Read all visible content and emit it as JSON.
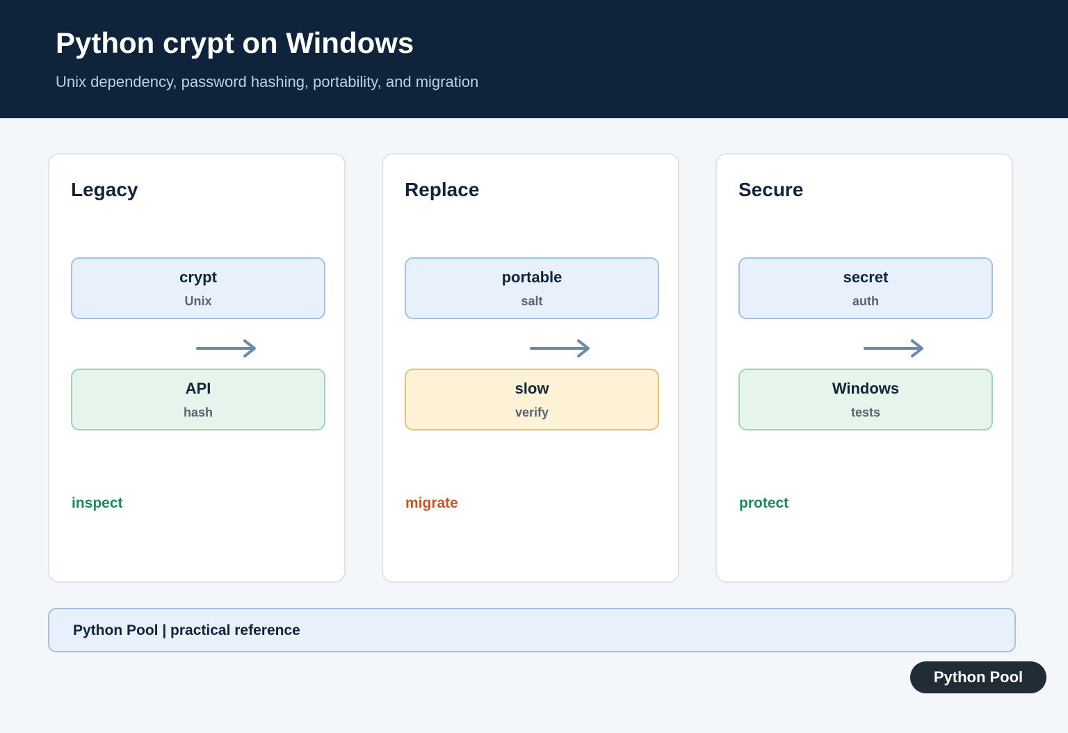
{
  "header": {
    "title": "Python crypt on Windows",
    "subtitle": "Unix dependency, password hashing, portability, and migration"
  },
  "panels": [
    {
      "title": "Legacy",
      "top_node": {
        "label": "crypt",
        "sub": "Unix",
        "style": "blue"
      },
      "bottom_node": {
        "label": "API",
        "sub": "hash",
        "style": "green"
      },
      "action": "inspect",
      "action_color": "#1e8a55"
    },
    {
      "title": "Replace",
      "top_node": {
        "label": "portable",
        "sub": "salt",
        "style": "blue"
      },
      "bottom_node": {
        "label": "slow",
        "sub": "verify",
        "style": "yellow"
      },
      "action": "migrate",
      "action_color": "#c0582a"
    },
    {
      "title": "Secure",
      "top_node": {
        "label": "secret",
        "sub": "auth",
        "style": "blue"
      },
      "bottom_node": {
        "label": "Windows",
        "sub": "tests",
        "style": "green"
      },
      "action": "protect",
      "action_color": "#1e8a55"
    }
  ],
  "arrow_icon": "right-arrow-icon",
  "colors": {
    "header_bg": "#0f233b",
    "page_bg": "#f3f7fa",
    "node_blue": "#e8f0fb",
    "node_green": "#e5f5ec",
    "node_yellow": "#fdf2d6",
    "arrow": "#6b8aa7"
  },
  "footer": {
    "text": "Python Pool | practical reference"
  },
  "badge": {
    "label": "Python Pool"
  }
}
